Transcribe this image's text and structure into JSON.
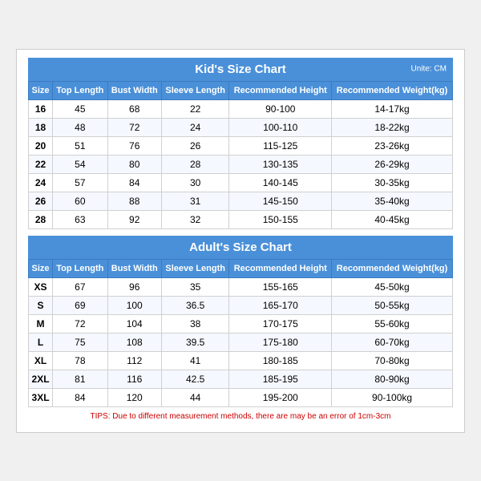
{
  "kids": {
    "title": "Kid's Size Chart",
    "unit": "Unite: CM",
    "headers": [
      "Size",
      "Top Length",
      "Bust Width",
      "Sleeve Length",
      "Recommended Height",
      "Recommended Weight(kg)"
    ],
    "rows": [
      [
        "16",
        "45",
        "68",
        "22",
        "90-100",
        "14-17kg"
      ],
      [
        "18",
        "48",
        "72",
        "24",
        "100-110",
        "18-22kg"
      ],
      [
        "20",
        "51",
        "76",
        "26",
        "115-125",
        "23-26kg"
      ],
      [
        "22",
        "54",
        "80",
        "28",
        "130-135",
        "26-29kg"
      ],
      [
        "24",
        "57",
        "84",
        "30",
        "140-145",
        "30-35kg"
      ],
      [
        "26",
        "60",
        "88",
        "31",
        "145-150",
        "35-40kg"
      ],
      [
        "28",
        "63",
        "92",
        "32",
        "150-155",
        "40-45kg"
      ]
    ]
  },
  "adults": {
    "title": "Adult's Size Chart",
    "headers": [
      "Size",
      "Top Length",
      "Bust Width",
      "Sleeve Length",
      "Recommended Height",
      "Recommended Weight(kg)"
    ],
    "rows": [
      [
        "XS",
        "67",
        "96",
        "35",
        "155-165",
        "45-50kg"
      ],
      [
        "S",
        "69",
        "100",
        "36.5",
        "165-170",
        "50-55kg"
      ],
      [
        "M",
        "72",
        "104",
        "38",
        "170-175",
        "55-60kg"
      ],
      [
        "L",
        "75",
        "108",
        "39.5",
        "175-180",
        "60-70kg"
      ],
      [
        "XL",
        "78",
        "112",
        "41",
        "180-185",
        "70-80kg"
      ],
      [
        "2XL",
        "81",
        "116",
        "42.5",
        "185-195",
        "80-90kg"
      ],
      [
        "3XL",
        "84",
        "120",
        "44",
        "195-200",
        "90-100kg"
      ]
    ]
  },
  "tips": "TIPS: Due to different measurement methods, there are may be an error of 1cm-3cm"
}
